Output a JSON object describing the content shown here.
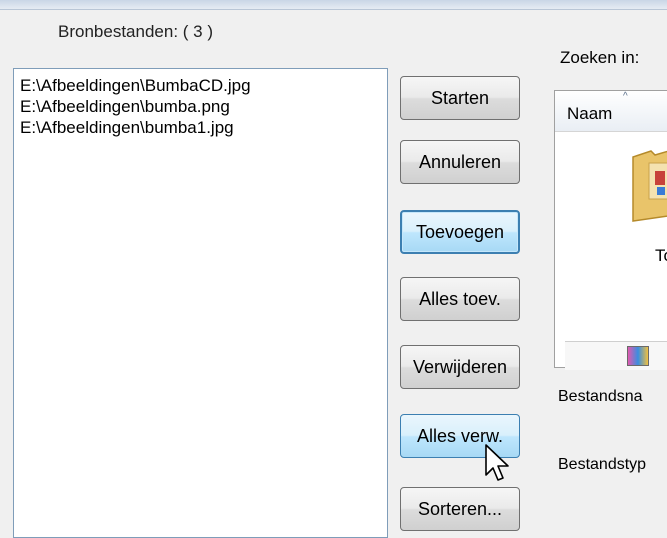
{
  "source_files": {
    "label": "Bronbestanden:  ( 3 )",
    "items": [
      "E:\\Afbeeldingen\\BumbaCD.jpg",
      "E:\\Afbeeldingen\\bumba.png",
      "E:\\Afbeeldingen\\bumba1.jpg"
    ]
  },
  "buttons": {
    "start": "Starten",
    "cancel": "Annuleren",
    "add": "Toevoegen",
    "add_all": "Alles toev.",
    "remove": "Verwijderen",
    "remove_all": "Alles verw.",
    "sort": "Sorteren..."
  },
  "browser": {
    "look_in": "Zoeken in:",
    "column_name": "Naam",
    "folder_label": "To",
    "file_name_label": "Bestandsna",
    "file_type_label": "Bestandstyp"
  },
  "colors": {
    "focus_border": "#3c7fb1",
    "hover_fill": "#bee6fd"
  }
}
